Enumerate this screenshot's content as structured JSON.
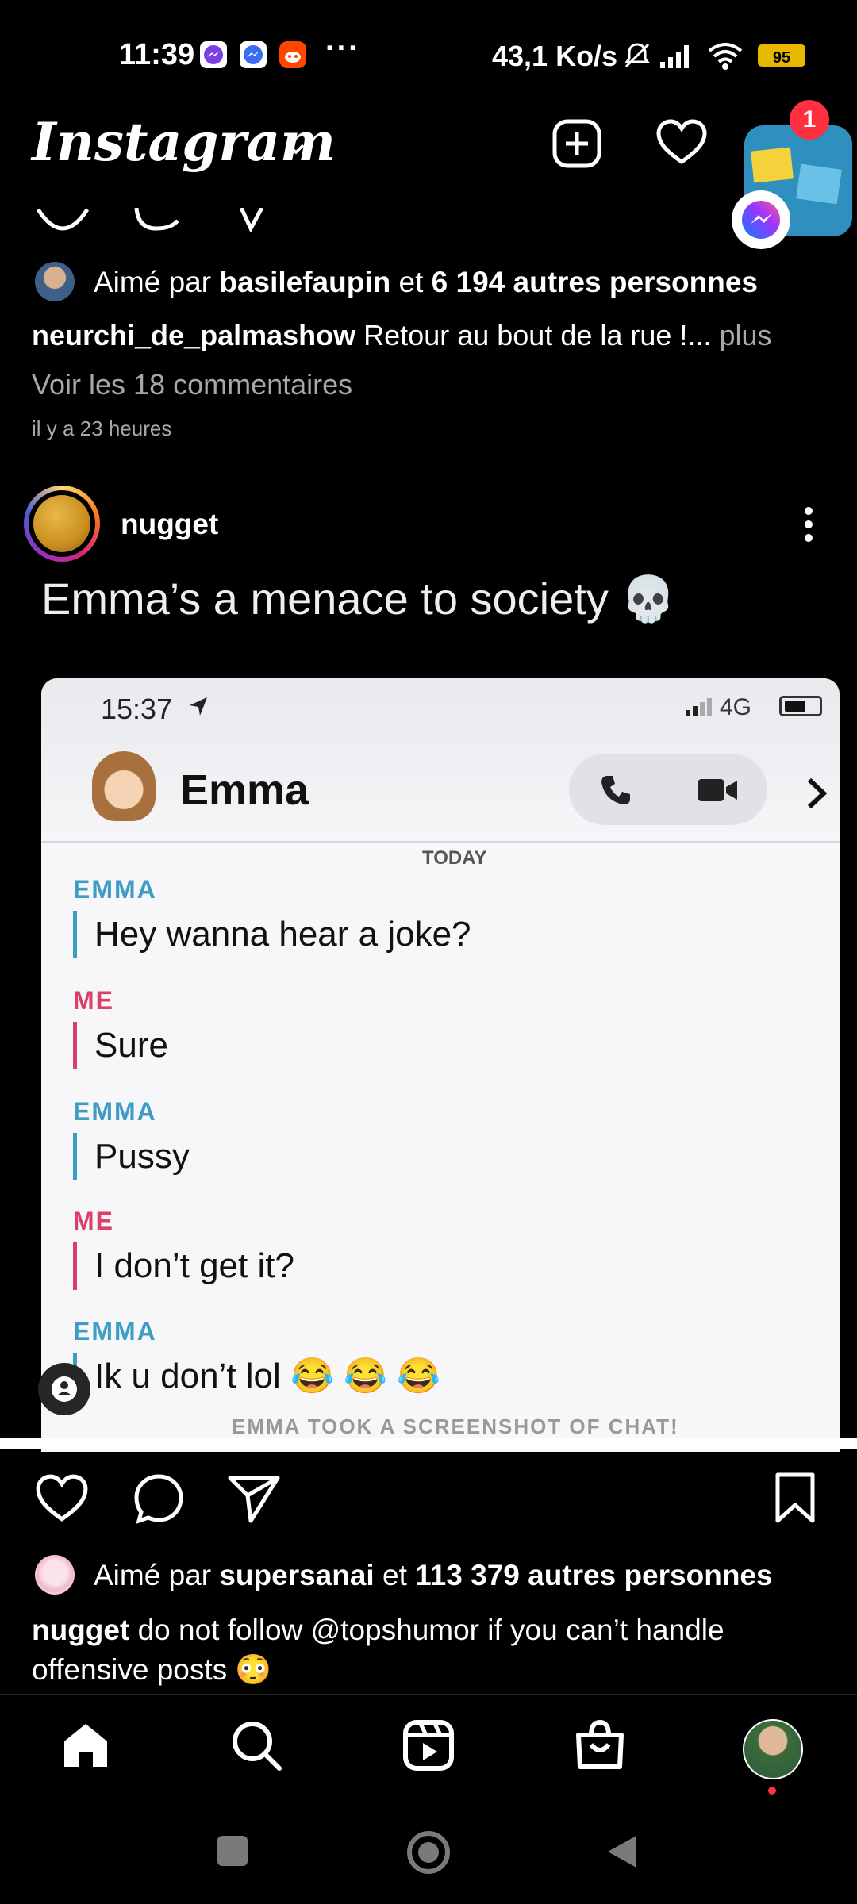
{
  "status_bar": {
    "time": "11:39",
    "more": "···",
    "net_speed": "43,1 Ko/s",
    "battery": "95"
  },
  "header": {
    "logo": "Instagram"
  },
  "notification_badge": "1",
  "prev_post": {
    "liked_prefix": "Aimé par",
    "liked_user": "basilefaupin",
    "liked_and": "et",
    "liked_others": "6 194 autres personnes",
    "caption_user": "neurchi_de_palmashow",
    "caption_text": "Retour au bout de la rue !...",
    "caption_more": "plus",
    "comments": "Voir les 18 commentaires",
    "time_ago": "il y a 23 heures"
  },
  "post": {
    "username": "nugget",
    "image_title": "Emma’s a menace to society 💀",
    "phone": {
      "time": "15:37",
      "network": "4G",
      "contact": "Emma",
      "today": "TODAY",
      "messages": [
        {
          "who": "EMMA",
          "text": "Hey wanna hear a joke?"
        },
        {
          "who": "ME",
          "text": "Sure"
        },
        {
          "who": "EMMA",
          "text": "Pussy"
        },
        {
          "who": "ME",
          "text": "I don’t get it?"
        },
        {
          "who": "EMMA",
          "text": "Ik u don’t lol 😂 😂 😂"
        }
      ],
      "screenshot_note": "EMMA TOOK A SCREENSHOT OF CHAT!"
    },
    "liked_prefix": "Aimé par",
    "liked_user": "supersanai",
    "liked_and": "et",
    "liked_others": "113 379 autres personnes",
    "caption_user": "nugget",
    "caption_text": "do not follow @topshumor if you can’t handle offensive posts 😳"
  }
}
